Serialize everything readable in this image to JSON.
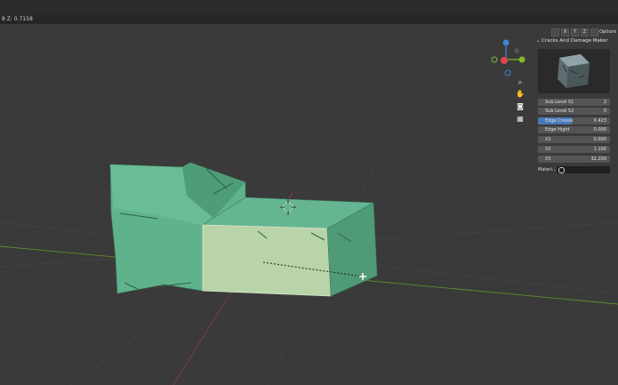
{
  "status": {
    "coords": "8  Z: 0.7158"
  },
  "viewport_header": {
    "buttons": [
      "X",
      "Y",
      "Z"
    ],
    "options_label": "Options"
  },
  "gizmo": {
    "x_label": "",
    "y_label": "",
    "z_label": ""
  },
  "panel": {
    "title": "Cracks And Damage Maker",
    "properties": [
      {
        "label": "Sub Level S1",
        "value": "2"
      },
      {
        "label": "Sub Level S2",
        "value": "0"
      },
      {
        "label": "Edge Crease",
        "value": "0.423"
      },
      {
        "label": "Edge Hight",
        "value": "0.000"
      },
      {
        "label": "X1",
        "value": "0.000"
      },
      {
        "label": "X2",
        "value": "1.100"
      },
      {
        "label": "X3",
        "value": "32.200"
      }
    ],
    "material_label": "Materi..."
  },
  "colors": {
    "mesh": "#5fb38c",
    "mesh_selected": "#b8d4a8",
    "x_axis": "#e0444e",
    "y_axis": "#7fbb2a",
    "z_axis": "#3e86d6"
  }
}
